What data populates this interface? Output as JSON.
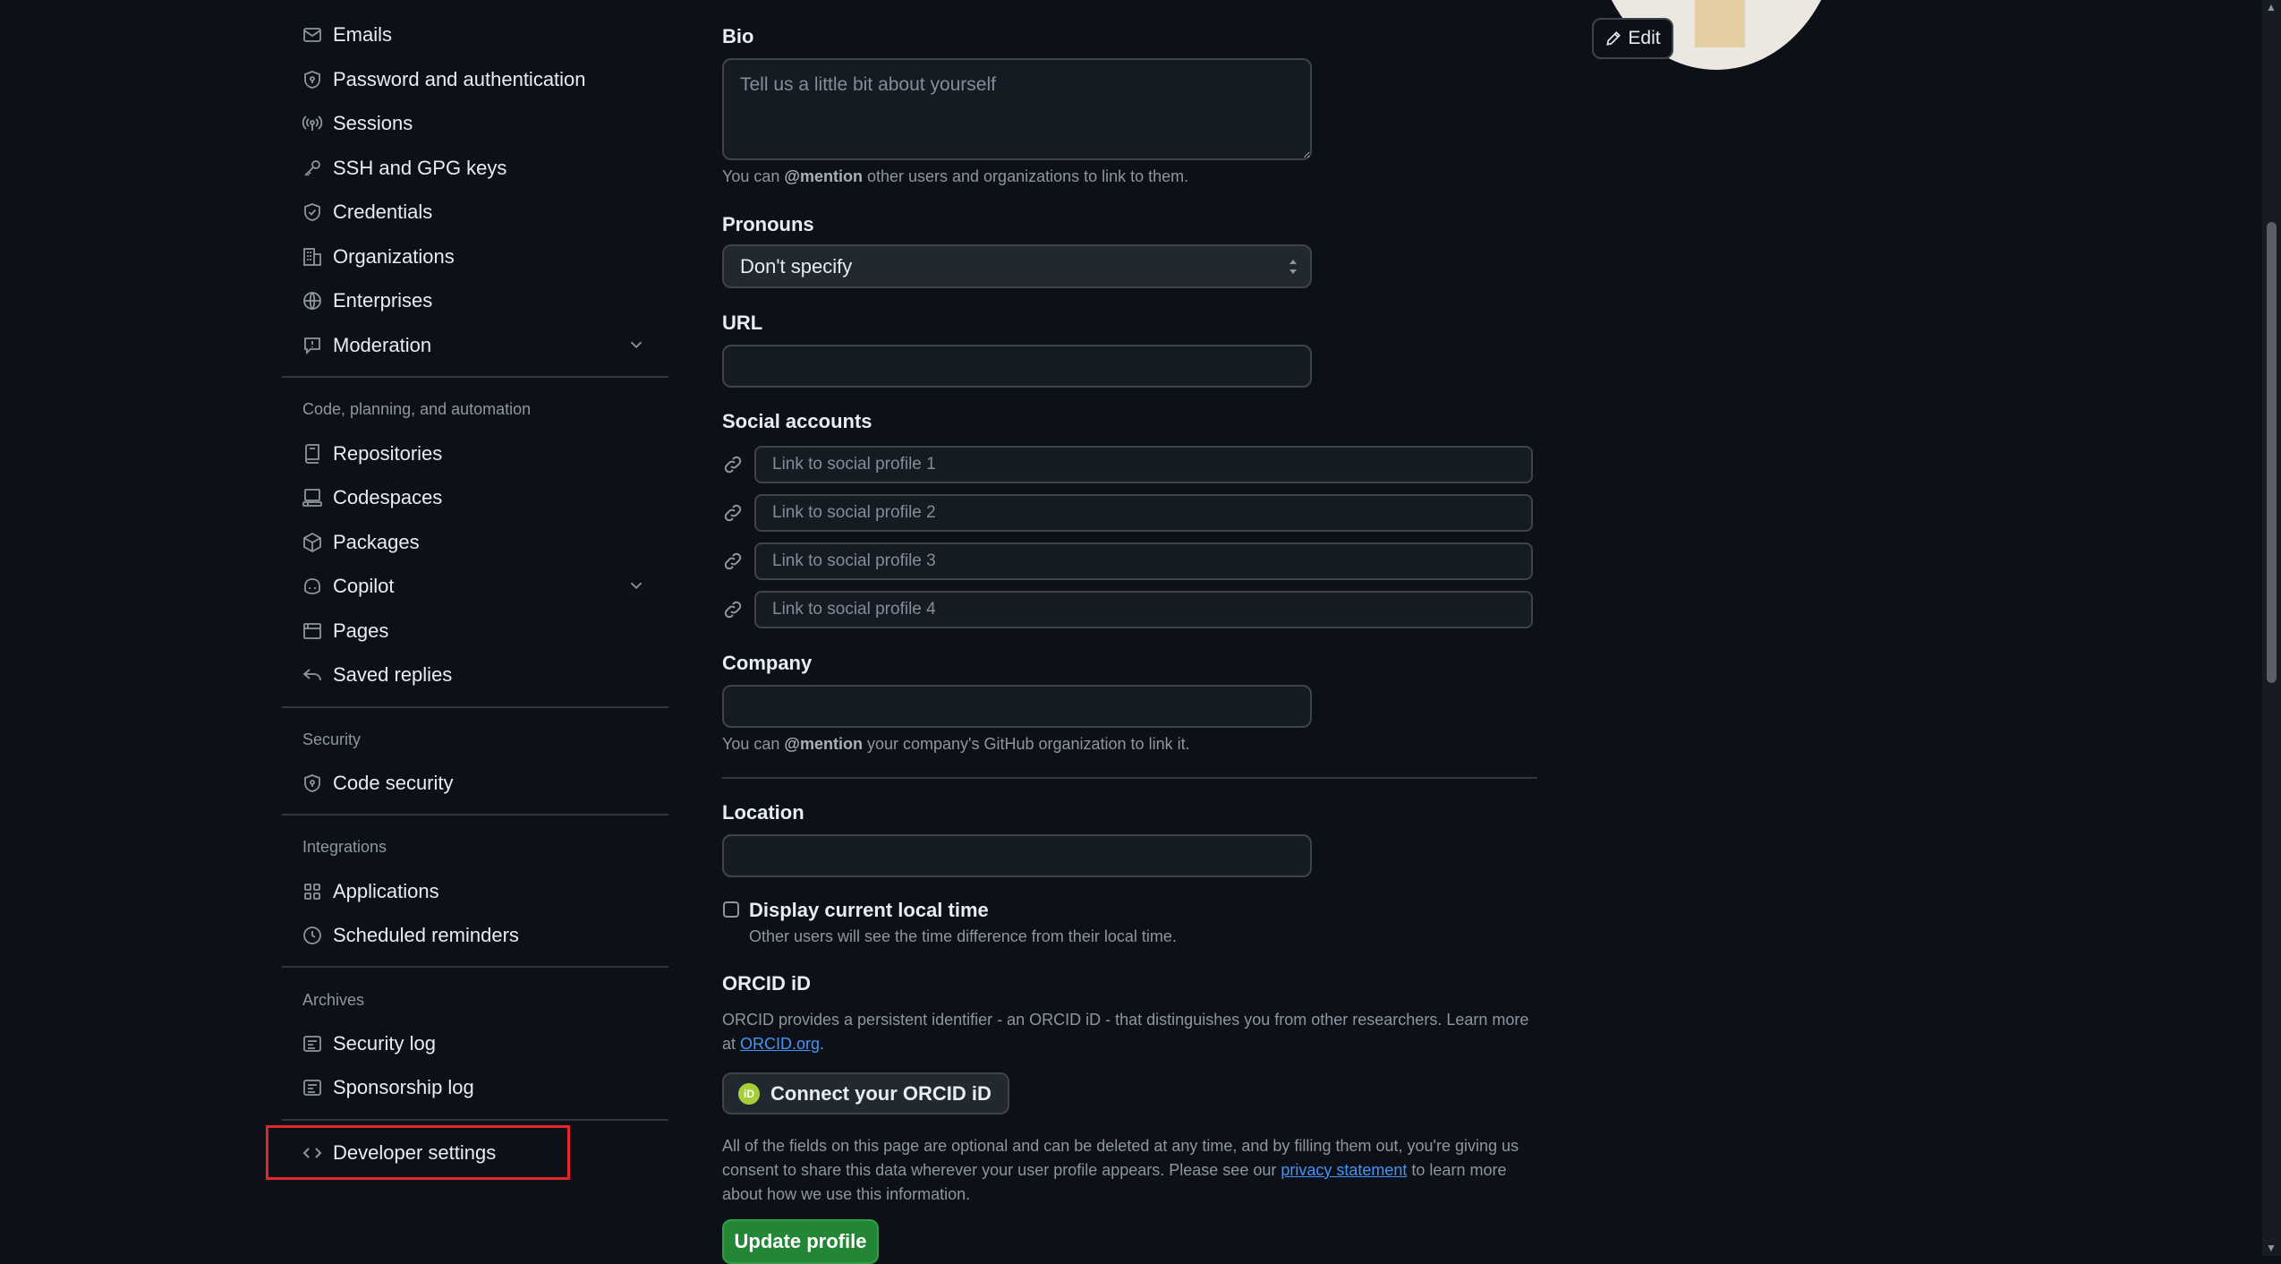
{
  "sidebar": {
    "items_top": [
      {
        "label": "Emails",
        "icon": "mail-icon"
      },
      {
        "label": "Password and authentication",
        "icon": "shield-lock-icon"
      },
      {
        "label": "Sessions",
        "icon": "broadcast-icon"
      },
      {
        "label": "SSH and GPG keys",
        "icon": "key-icon"
      },
      {
        "label": "Credentials",
        "icon": "shield-check-icon"
      },
      {
        "label": "Organizations",
        "icon": "organization-icon"
      },
      {
        "label": "Enterprises",
        "icon": "globe-icon"
      },
      {
        "label": "Moderation",
        "icon": "report-icon"
      }
    ],
    "section_code": "Code, planning, and automation",
    "items_code": [
      {
        "label": "Repositories",
        "icon": "repo-icon"
      },
      {
        "label": "Codespaces",
        "icon": "codespaces-icon"
      },
      {
        "label": "Packages",
        "icon": "package-icon"
      },
      {
        "label": "Copilot",
        "icon": "copilot-icon"
      },
      {
        "label": "Pages",
        "icon": "browser-icon"
      },
      {
        "label": "Saved replies",
        "icon": "reply-icon"
      }
    ],
    "section_security": "Security",
    "items_security": [
      {
        "label": "Code security",
        "icon": "shield-lock-icon"
      }
    ],
    "section_integrations": "Integrations",
    "items_integrations": [
      {
        "label": "Applications",
        "icon": "apps-icon"
      },
      {
        "label": "Scheduled reminders",
        "icon": "clock-icon"
      }
    ],
    "section_archives": "Archives",
    "items_archives": [
      {
        "label": "Security log",
        "icon": "log-icon"
      },
      {
        "label": "Sponsorship log",
        "icon": "log-icon"
      }
    ],
    "developer_settings": "Developer settings"
  },
  "form": {
    "bio_label": "Bio",
    "bio_placeholder": "Tell us a little bit about yourself",
    "bio_help_pre": "You can ",
    "bio_help_mention": "@mention",
    "bio_help_post": " other users and organizations to link to them.",
    "pronouns_label": "Pronouns",
    "pronouns_value": "Don't specify",
    "url_label": "URL",
    "social_label": "Social accounts",
    "social_placeholders": [
      "Link to social profile 1",
      "Link to social profile 2",
      "Link to social profile 3",
      "Link to social profile 4"
    ],
    "company_label": "Company",
    "company_help_pre": "You can ",
    "company_help_mention": "@mention",
    "company_help_post": " your company's GitHub organization to link it.",
    "location_label": "Location",
    "local_time_label": "Display current local time",
    "local_time_help": "Other users will see the time difference from their local time.",
    "orcid_label": "ORCID iD",
    "orcid_desc": "ORCID provides a persistent identifier - an ORCID iD - that distinguishes you from other researchers. Learn more at",
    "orcid_link": "ORCID.org",
    "orcid_period": ".",
    "orcid_button": "Connect your ORCID iD",
    "orcid_logo_text": "iD",
    "disclaimer_pre": "All of the fields on this page are optional and can be deleted at any time, and by filling them out, you're giving us consent to share this data wherever your user profile appears. Please see our ",
    "disclaimer_link": "privacy statement",
    "disclaimer_post": " to learn more about how we use this information.",
    "update_button": "Update profile"
  },
  "avatar": {
    "edit_label": "Edit"
  },
  "colors": {
    "background": "#0d1117",
    "accent_green": "#238636",
    "link_blue": "#4493f8",
    "highlight_red": "#e5252a"
  }
}
